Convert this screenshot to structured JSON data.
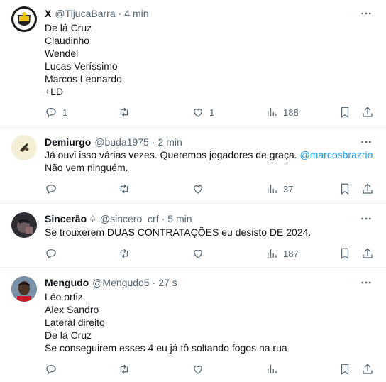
{
  "tweets": [
    {
      "name": "X",
      "handle": "@TijucaBarra",
      "dot": "·",
      "time": "4 min",
      "lines": [
        "De lá Cruz",
        "Claudinho",
        "Wendel",
        "Lucas Veríssimo",
        "Marcos Leonardo",
        "+LD"
      ],
      "replies": "1",
      "retweets": "",
      "likes": "1",
      "views": "188"
    },
    {
      "name": "Demiurgo",
      "handle": "@buda1975",
      "dot": "·",
      "time": "2 min",
      "line1_text": "Já ouvi isso várias vezes. Queremos jogadores de graça.",
      "line1_mention": "@marcosbrazrio",
      "line2": "Não vem ninguém.",
      "replies": "",
      "retweets": "",
      "likes": "",
      "views": "37"
    },
    {
      "name": "Sincerão",
      "name_badge": "♤",
      "handle": "@sincero_crf",
      "dot": "·",
      "time": "5 min",
      "lines": [
        "Se trouxerem DUAS CONTRATAÇÕES eu desisto DE 2024."
      ],
      "replies": "",
      "retweets": "",
      "likes": "",
      "views": "187"
    },
    {
      "name": "Mengudo",
      "handle": "@Mengudo5",
      "dot": "·",
      "time": "27 s",
      "lines": [
        "Léo ortiz",
        "Alex Sandro",
        "Lateral direito",
        "De lá Cruz",
        "Se conseguirem esses 4 eu já tô soltando fogos na rua"
      ],
      "replies": "",
      "retweets": "",
      "likes": "",
      "views": ""
    }
  ],
  "colors": {
    "text": "#0f1419",
    "secondary": "#536471",
    "link": "#1d9bf0",
    "divider": "#eff3f4"
  },
  "icons": {
    "reply": "reply-icon",
    "retweet": "retweet-icon",
    "like": "heart-icon",
    "views": "views-icon",
    "bookmark": "bookmark-icon",
    "share": "share-icon",
    "more": "more-icon"
  }
}
